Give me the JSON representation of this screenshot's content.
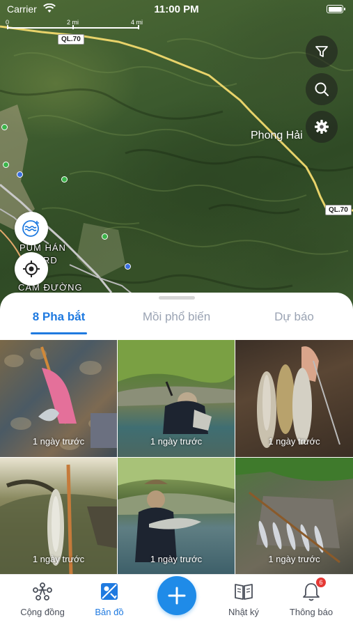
{
  "status_bar": {
    "carrier": "Carrier",
    "time": "11:00 PM"
  },
  "map": {
    "scale": {
      "zero": "0",
      "mid": "2 mi",
      "end": "4 mi"
    },
    "road_labels": [
      "QL.70",
      "QL.70"
    ],
    "places": {
      "phong_hai": "Phong Hải",
      "pum_han": "PÚM HÁN",
      "rd": "RD",
      "cam_duong": "CAM ĐƯỜNG"
    },
    "buttons": {
      "filter": "filter-icon",
      "search": "search-icon",
      "settings": "gear-icon",
      "weather": "water-icon",
      "locate": "locate-icon"
    }
  },
  "sheet": {
    "tabs": [
      {
        "label": "8 Pha bắt",
        "active": true
      },
      {
        "label": "Mồi phổ biến",
        "active": false
      },
      {
        "label": "Dự báo",
        "active": false
      }
    ],
    "catches": [
      {
        "caption": "1 ngày trước"
      },
      {
        "caption": "1 ngày trước"
      },
      {
        "caption": "1 ngày trước"
      },
      {
        "caption": "1 ngày trước"
      },
      {
        "caption": "1 ngày trước"
      },
      {
        "caption": "1 ngày trước"
      }
    ]
  },
  "bottom_nav": {
    "items": [
      {
        "label": "Cộng đồng",
        "icon": "community-icon"
      },
      {
        "label": "Bản đồ",
        "icon": "map-icon",
        "active": true
      },
      {
        "label": "Nhật ký",
        "icon": "book-icon"
      },
      {
        "label": "Thông báo",
        "icon": "bell-icon",
        "badge": "6"
      }
    ],
    "add_icon": "plus-icon"
  },
  "colors": {
    "accent": "#1f7ae0",
    "fab": "#1f8be8",
    "badge": "#e53935"
  }
}
